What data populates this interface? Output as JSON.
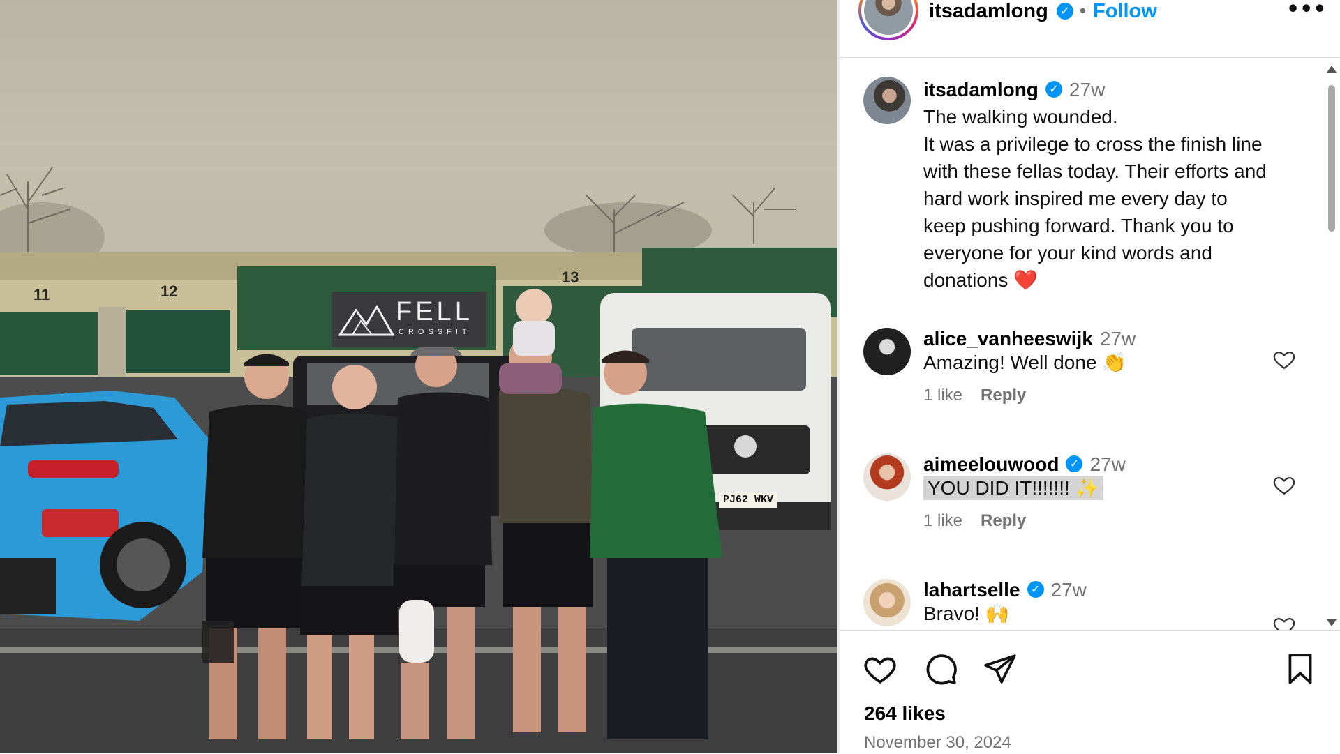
{
  "post": {
    "username": "itsadamlong",
    "verified_mark": "✓",
    "separator": "•",
    "follow_label": "Follow",
    "more_icon": "•••",
    "more_icon_name": "more-options-icon",
    "photo": {
      "building_numbers": [
        "11",
        "12",
        "13"
      ],
      "sign_text": "FELL",
      "sign_subtext": "CROSSFIT",
      "plate_text": "PJ62 WKV"
    },
    "caption": {
      "username": "itsadamlong",
      "time": "27w",
      "text": "The walking wounded.\nIt was a privilege to cross the finish line\nwith these fellas today. Their efforts and\nhard work inspired me every day to\nkeep pushing forward. Thank you to\neveryone for your kind words and\ndonations ❤️"
    },
    "comments": [
      {
        "username": "alice_vanheeswijk",
        "time": "27w",
        "verified": false,
        "text": "Amazing! Well done 👏",
        "likes": "1 like",
        "reply": "Reply"
      },
      {
        "username": "aimeelouwood",
        "time": "27w",
        "verified": true,
        "text": "YOU DID IT!!!!!!! ✨",
        "likes": "1 like",
        "reply": "Reply"
      },
      {
        "username": "lahartselle",
        "time": "27w",
        "verified": true,
        "text": "Bravo! 🙌"
      }
    ],
    "likes_count": "264 likes",
    "date": "November 30, 2024"
  },
  "colors": {
    "accent": "#0095f6",
    "muted": "#737373",
    "heart_red": "#ed4956"
  }
}
